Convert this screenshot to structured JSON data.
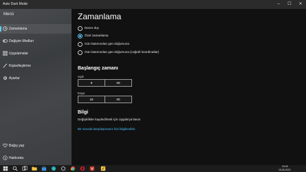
{
  "window": {
    "title": "Auto Dark Mode"
  },
  "sidebar": {
    "menu_label": "Menü",
    "items": [
      {
        "label": "Zamanlama",
        "icon": "clock-icon",
        "selected": true
      },
      {
        "label": "Değişim Modları",
        "icon": "toggle-icon",
        "selected": false
      },
      {
        "label": "Uygulamalar",
        "icon": "apps-icon",
        "selected": false
      },
      {
        "label": "Kişiselleştirme",
        "icon": "brush-icon",
        "selected": false
      },
      {
        "label": "Ayarlar",
        "icon": "gear-icon",
        "selected": false
      }
    ],
    "bottom_items": [
      {
        "label": "Bağış yap",
        "icon": "heart-icon"
      },
      {
        "label": "Hakkında",
        "icon": "info-icon"
      }
    ]
  },
  "main": {
    "title": "Zamanlama",
    "mode_options": [
      {
        "label": "Devre dışı",
        "checked": false
      },
      {
        "label": "Özel zamanlama",
        "checked": true
      },
      {
        "label": "Gün batımından gün doğumuna",
        "checked": false
      },
      {
        "label": "Gün batımından gün doğumuna (coğrafi koordinatlar)",
        "checked": false
      }
    ],
    "start_time_title": "Başlangıç zamanı",
    "light": {
      "label": "Açık",
      "hour": "8",
      "minute": "00"
    },
    "dark": {
      "label": "Koyu",
      "hour": "18",
      "minute": "00"
    },
    "info_title": "Bilgi",
    "info_text": "Değişiklikler kaydedilmek için Uygula'ya basın",
    "info_link": "Bir sorunla karşılaşırsanız bizi bilgilendirin"
  },
  "taskbar": {
    "time": "23:09",
    "date": "15.06.2022",
    "icons": [
      "start-icon",
      "search-icon",
      "task-view-icon",
      "file-explorer-icon",
      "store-icon",
      "edge-icon",
      "settings-icon",
      "chrome-icon",
      "opera-icon",
      "vpn-icon",
      "auto-dark-mode-icon"
    ]
  },
  "colors": {
    "accent": "#60cdff",
    "link": "#4cc2ff",
    "background": "#111111"
  }
}
